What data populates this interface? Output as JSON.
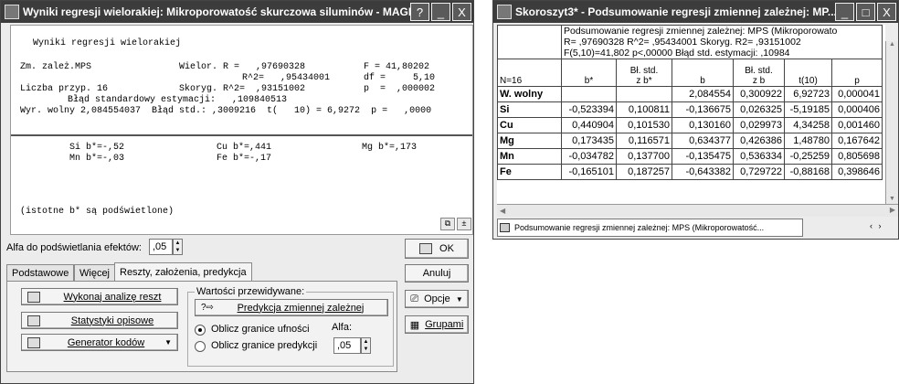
{
  "left": {
    "title": "Wyniki regresji wielorakiej: Mikroporowatość skurczowa siluminów - MAGMA",
    "titlebar_buttons": [
      "?",
      "_",
      "X"
    ],
    "results": {
      "heading": "Wyniki regresji wielorakiej",
      "line1_col1": "Zm. zależ.MPS",
      "line1_col2": "Wielor. R =   ,97690328",
      "line1_col3": "F = 41,80202",
      "line2_col2": "R^2=   ,95434001",
      "line2_col3": "df =     5,10",
      "line3_col1": "Liczba przyp. 16",
      "line3_col2": "Skoryg. R^2=  ,93151002",
      "line3_col3": "p  =  ,000002",
      "line4": "Błąd standardowy estymacji:   ,109840513",
      "line5": "Wyr. wolny 2,084554037  Błąd std.: ,3009216  t(   10) = 6,9272  p =   ,0000",
      "coef_row1": [
        "Si b*=-,52",
        "Cu b*=,441",
        "Mg b*=,173"
      ],
      "coef_row2": [
        "Mn b*=-,03",
        "Fe b*=-,17"
      ],
      "note": "(istotne b* są podświetlone)"
    },
    "alpha_effects_label": "Alfa do podświetlania efektów:",
    "alpha_effects_value": ",05",
    "ok_label": "OK",
    "cancel_label": "Anuluj",
    "options_label": "Opcje",
    "groups_label": "Grupami",
    "tabs": [
      "Podstawowe",
      "Więcej",
      "Reszty, założenia, predykcja"
    ],
    "residual_analysis_label": "Wykonaj analizę reszt",
    "descriptive_stats_label": "Statystyki opisowe",
    "code_generator_label": "Generator kodów",
    "predicted_group_title": "Wartości przewidywane:",
    "predict_button_label": "Predykcja zmiennej zależnej",
    "radio_confidence_label": "Oblicz granice ufności",
    "radio_prediction_label": "Oblicz granice predykcji",
    "alpha_label": "Alfa:",
    "alpha_value": ",05"
  },
  "right": {
    "title": "Skoroszyt3* - Podsumowanie regresji zmiennej zależnej: MP...",
    "titlebar_buttons": [
      "_",
      "□",
      "X"
    ],
    "caption_line1": "Podsumowanie regresji zmiennej zależnej:  MPS (Mikroporowato",
    "caption_line2": "R= ,97690328 R^2= ,95434001 Skoryg. R2= ,93151002",
    "caption_line3": "F(5,10)=41,802 p<,00000 Błąd std. estymacji: ,10984",
    "corner_label": "N=16",
    "columns": [
      {
        "line1": "b*",
        "line2": ""
      },
      {
        "line1": "Bł. std.",
        "line2": "z b*"
      },
      {
        "line1": "b",
        "line2": ""
      },
      {
        "line1": "Bł. std.",
        "line2": "z b"
      },
      {
        "line1": "t(10)",
        "line2": ""
      },
      {
        "line1": "p",
        "line2": ""
      }
    ],
    "rows": [
      {
        "label": "W. wolny",
        "values": [
          "",
          "",
          "2,084554",
          "0,300922",
          "6,92723",
          "0,000041"
        ]
      },
      {
        "label": "Si",
        "values": [
          "-0,523394",
          "0,100811",
          "-0,136675",
          "0,026325",
          "-5,19185",
          "0,000406"
        ]
      },
      {
        "label": "Cu",
        "values": [
          "0,440904",
          "0,101530",
          "0,130160",
          "0,029973",
          "4,34258",
          "0,001460"
        ]
      },
      {
        "label": "Mg",
        "values": [
          "0,173435",
          "0,116571",
          "0,634377",
          "0,426386",
          "1,48780",
          "0,167642"
        ]
      },
      {
        "label": "Mn",
        "values": [
          "-0,034782",
          "0,137700",
          "-0,135475",
          "0,536334",
          "-0,25259",
          "0,805698"
        ]
      },
      {
        "label": "Fe",
        "values": [
          "-0,165101",
          "0,187257",
          "-0,643382",
          "0,729722",
          "-0,88168",
          "0,398646"
        ]
      }
    ],
    "sheet_tab_label": "Podsumowanie regresji zmiennej zależnej: MPS (Mikroporowatość..."
  }
}
